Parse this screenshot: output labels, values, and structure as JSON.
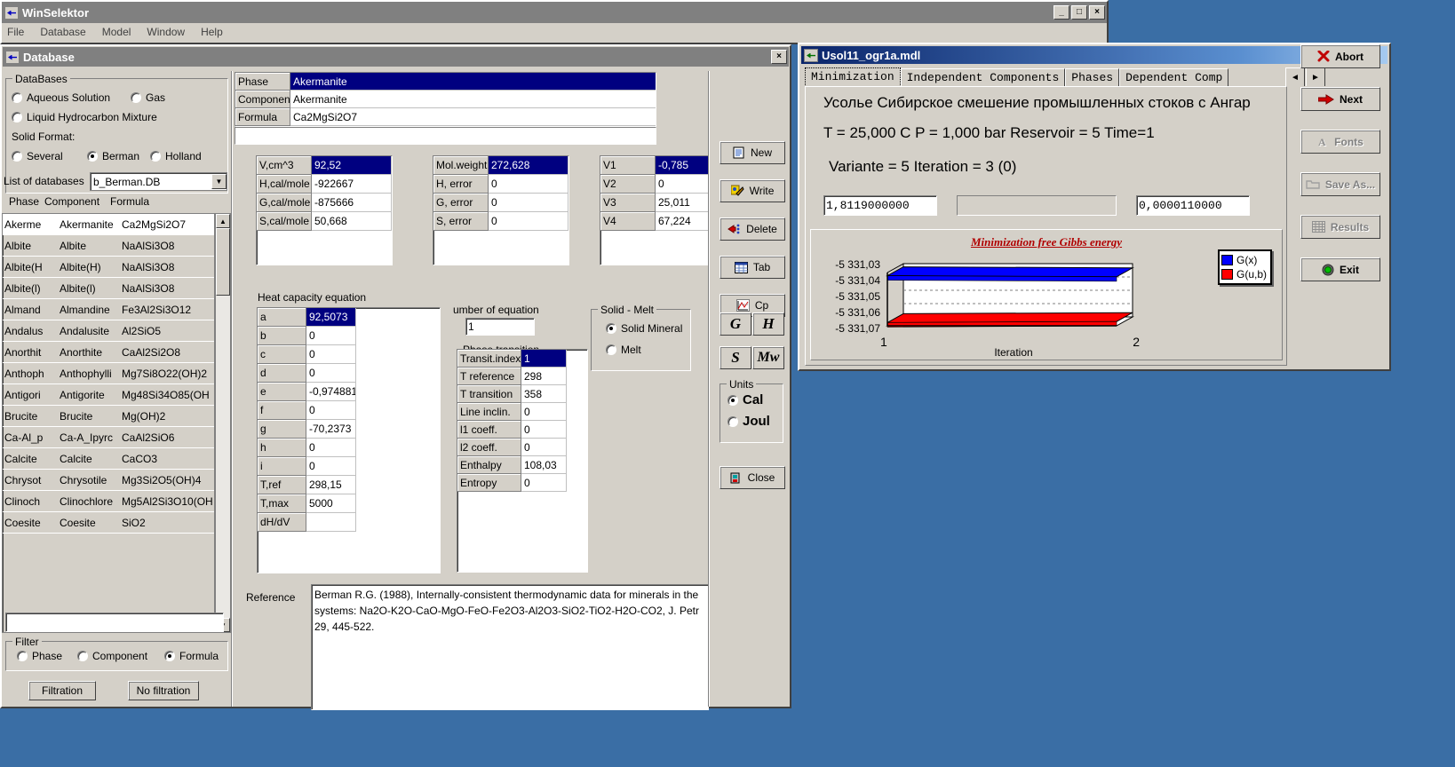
{
  "app": {
    "title": "WinSelektor",
    "menu": [
      "File",
      "Database",
      "Model",
      "Window",
      "Help"
    ],
    "min": "_",
    "max": "□",
    "close": "×"
  },
  "database_window": {
    "title": "Database",
    "close": "×",
    "databases_group": {
      "label": "DataBases",
      "options": [
        {
          "label": "Aqueous Solution",
          "selected": false
        },
        {
          "label": "Gas",
          "selected": false
        },
        {
          "label": "Liquid Hydrocarbon Mixture",
          "selected": false
        }
      ],
      "solid_format_label": "Solid Format:",
      "solid_options": [
        {
          "label": "Several",
          "selected": false
        },
        {
          "label": "Berman",
          "selected": true
        },
        {
          "label": "Holland",
          "selected": false
        }
      ]
    },
    "db_list": {
      "label": "List of databases",
      "value": "b_Berman.DB"
    },
    "table": {
      "headers": [
        "Phase",
        "Component",
        "Formula"
      ],
      "rows": [
        {
          "phase": "Akerme",
          "component": "Akermanite",
          "formula": "Ca2MgSi2O7",
          "selected": true
        },
        {
          "phase": "Albite",
          "component": "Albite",
          "formula": "NaAlSi3O8",
          "selected": false
        },
        {
          "phase": "Albite(H",
          "component": "Albite(H)",
          "formula": "NaAlSi3O8",
          "selected": false
        },
        {
          "phase": "Albite(l)",
          "component": "Albite(l)",
          "formula": "NaAlSi3O8",
          "selected": false
        },
        {
          "phase": "Almand",
          "component": "Almandine",
          "formula": "Fe3Al2Si3O12",
          "selected": false
        },
        {
          "phase": "Andalus",
          "component": "Andalusite",
          "formula": "Al2SiO5",
          "selected": false
        },
        {
          "phase": "Anorthit",
          "component": "Anorthite",
          "formula": "CaAl2Si2O8",
          "selected": false
        },
        {
          "phase": "Anthoph",
          "component": "Anthophylli",
          "formula": "Mg7Si8O22(OH)2",
          "selected": false
        },
        {
          "phase": "Antigori",
          "component": "Antigorite",
          "formula": "Mg48Si34O85(OH",
          "selected": false
        },
        {
          "phase": "Brucite",
          "component": "Brucite",
          "formula": "Mg(OH)2",
          "selected": false
        },
        {
          "phase": "Ca-Al_p",
          "component": "Ca-A_Ipyrc",
          "formula": "CaAl2SiO6",
          "selected": false
        },
        {
          "phase": "Calcite",
          "component": "Calcite",
          "formula": "CaCO3",
          "selected": false
        },
        {
          "phase": "Chrysot",
          "component": "Chrysotile",
          "formula": "Mg3Si2O5(OH)4",
          "selected": false
        },
        {
          "phase": "Clinoch",
          "component": "Clinochlore",
          "formula": "Mg5Al2Si3O10(OH",
          "selected": false
        },
        {
          "phase": "Coesite",
          "component": "Coesite",
          "formula": "SiO2",
          "selected": false
        }
      ]
    },
    "search_value": "",
    "filter_group": {
      "label": "Filter",
      "options": [
        {
          "label": "Phase",
          "selected": false
        },
        {
          "label": "Component",
          "selected": false
        },
        {
          "label": "Formula",
          "selected": true
        }
      ],
      "filtration_button": "Filtration",
      "no_filtration_button": "No filtration"
    },
    "identity": {
      "rows": [
        {
          "label": "Phase",
          "value": "Akermanite",
          "selected": true
        },
        {
          "label": "Component",
          "value": "Akermanite",
          "selected": false
        },
        {
          "label": "Formula",
          "value": "Ca2MgSi2O7",
          "selected": false
        }
      ]
    },
    "thermo_left": [
      {
        "label": "V,cm^3",
        "value": "92,52",
        "selected": true
      },
      {
        "label": "H,cal/mole",
        "value": "-922667",
        "selected": false
      },
      {
        "label": "G,cal/mole",
        "value": "-875666",
        "selected": false
      },
      {
        "label": "S,cal/mole",
        "value": "50,668",
        "selected": false
      }
    ],
    "thermo_mid": [
      {
        "label": "Mol.weight",
        "value": "272,628",
        "selected": true
      },
      {
        "label": "H, error",
        "value": "0",
        "selected": false
      },
      {
        "label": "G, error",
        "value": "0",
        "selected": false
      },
      {
        "label": "S, error",
        "value": "0",
        "selected": false
      }
    ],
    "thermo_right": [
      {
        "label": "V1",
        "value": "-0,785",
        "selected": true
      },
      {
        "label": "V2",
        "value": "0",
        "selected": false
      },
      {
        "label": "V3",
        "value": "25,011",
        "selected": false
      },
      {
        "label": "V4",
        "value": "67,224",
        "selected": false
      }
    ],
    "heat_capacity": {
      "title": "Heat capacity equation",
      "rows": [
        {
          "label": "a",
          "value": "92,5073",
          "selected": true
        },
        {
          "label": "b",
          "value": "0",
          "selected": false
        },
        {
          "label": "c",
          "value": "0",
          "selected": false
        },
        {
          "label": "d",
          "value": "0",
          "selected": false
        },
        {
          "label": "e",
          "value": "-0,974881",
          "selected": false
        },
        {
          "label": "f",
          "value": "0",
          "selected": false
        },
        {
          "label": "g",
          "value": "-70,2373",
          "selected": false
        },
        {
          "label": "h",
          "value": "0",
          "selected": false
        },
        {
          "label": "i",
          "value": "0",
          "selected": false
        },
        {
          "label": "T,ref",
          "value": "298,15",
          "selected": false
        },
        {
          "label": "T,max",
          "value": "5000",
          "selected": false
        },
        {
          "label": "dH/dV",
          "value": "",
          "selected": false
        }
      ]
    },
    "number_of_equation": {
      "label": "umber of equation",
      "value": "1"
    },
    "phase_transition": {
      "label": "Phase transition",
      "value": "1"
    },
    "solid_melt": {
      "label": "Solid - Melt",
      "options": [
        {
          "label": "Solid Mineral",
          "selected": true
        },
        {
          "label": "Melt",
          "selected": false
        }
      ]
    },
    "transit": [
      {
        "label": "Transit.index",
        "value": "1",
        "selected": true
      },
      {
        "label": "T reference",
        "value": "298",
        "selected": false
      },
      {
        "label": "T transition",
        "value": "358",
        "selected": false
      },
      {
        "label": "Line inclin.",
        "value": "0",
        "selected": false
      },
      {
        "label": "l1 coeff.",
        "value": "0",
        "selected": false
      },
      {
        "label": "l2 coeff.",
        "value": "0",
        "selected": false
      },
      {
        "label": "Enthalpy",
        "value": "108,03",
        "selected": false
      },
      {
        "label": "Entropy",
        "value": "0",
        "selected": false
      }
    ],
    "reference": {
      "label": "Reference",
      "text": "Berman R.G. (1988), Internally-consistent thermodynamic data for minerals in the systems: Na2O-K2O-CaO-MgO-FeO-Fe2O3-Al2O3-SiO2-TiO2-H2O-CO2, J. Petr 29, 445-522."
    },
    "buttons": [
      {
        "name": "new",
        "label": "New",
        "icon": "new-document-icon"
      },
      {
        "name": "write",
        "label": "Write",
        "icon": "write-pencil-icon"
      },
      {
        "name": "delete",
        "label": "Delete",
        "icon": "delete-icon"
      },
      {
        "name": "tab",
        "label": "Tab",
        "icon": "table-icon"
      },
      {
        "name": "cp",
        "label": "Cp",
        "icon": "chart-icon"
      }
    ],
    "letter_buttons": [
      "G",
      "H",
      "S",
      "Mw"
    ],
    "units_group": {
      "label": "Units",
      "options": [
        {
          "label": "Cal",
          "selected": true
        },
        {
          "label": "Joul",
          "selected": false
        }
      ]
    },
    "close_button": {
      "label": "Close",
      "icon": "close-door-icon"
    }
  },
  "model_window": {
    "title": "Usol11_ogr1a.mdl",
    "min": "_",
    "max": "□",
    "close": "×",
    "tabs": [
      {
        "label": "Minimization",
        "selected": true
      },
      {
        "label": "Independent Components",
        "selected": false
      },
      {
        "label": "Phases",
        "selected": false
      },
      {
        "label": "Dependent Comp",
        "selected": false
      }
    ],
    "tab_scroll_left": "◄",
    "tab_scroll_right": "►",
    "header_line1": "Усолье Сибирское смешение промышленных стоков с Ангар",
    "header_line2": "T = 25,000 C    P = 1,000 bar   Reservoir = 5   Time=1",
    "header_line3": "Variante = 5    Iteration = 3 (0)",
    "field1": "1,8119000000",
    "field2": "",
    "field3": "0,0000110000",
    "buttons": [
      {
        "name": "abort",
        "label": "Abort",
        "icon": "x-cross-icon",
        "disabled": false
      },
      {
        "name": "next",
        "label": "Next",
        "icon": "right-arrow-icon",
        "disabled": false
      },
      {
        "name": "fonts",
        "label": "Fonts",
        "icon": "font-a-icon",
        "disabled": true
      },
      {
        "name": "save-as",
        "label": "Save As...",
        "icon": "folder-icon",
        "disabled": true
      },
      {
        "name": "results",
        "label": "Results",
        "icon": "grid-icon",
        "disabled": true
      },
      {
        "name": "exit",
        "label": "Exit",
        "icon": "exit-icon",
        "disabled": false
      }
    ],
    "chart_data": {
      "type": "line",
      "title": "Minimization free Gibbs energy",
      "xlabel": "Iteration",
      "ylabel": "",
      "x": [
        1,
        2
      ],
      "xticklabels": [
        "1",
        "2"
      ],
      "yticklabels": [
        "-5 331,03",
        "-5 331,04",
        "-5 331,05",
        "-5 331,06",
        "-5 331,07"
      ],
      "ylim": [
        -5331.075,
        -5331.025
      ],
      "grid": true,
      "legend_position": "right",
      "series": [
        {
          "name": "G(x)",
          "color": "#0000ff",
          "values": [
            -5331.028,
            -5331.029
          ]
        },
        {
          "name": "G(u,b)",
          "color": "#ff0000",
          "values": [
            -5331.072,
            -5331.071
          ]
        }
      ]
    }
  }
}
